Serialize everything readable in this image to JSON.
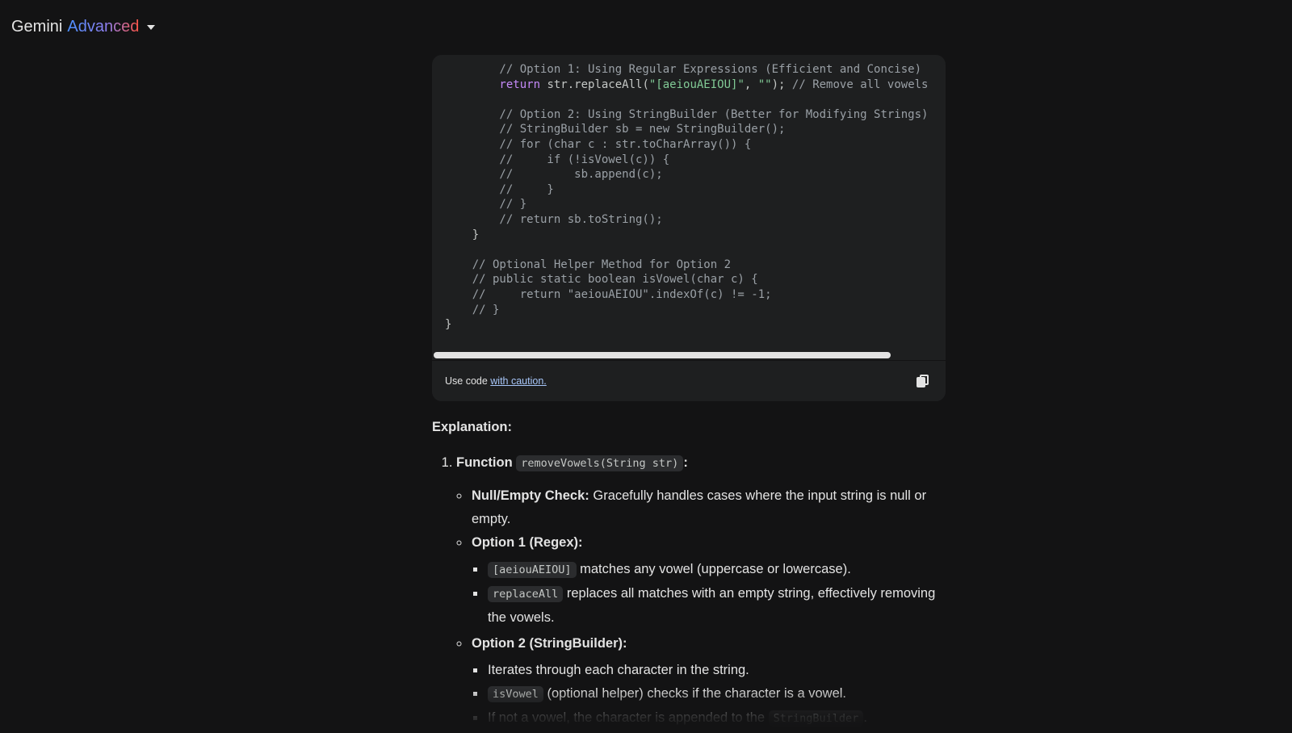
{
  "header": {
    "brand_name": "Gemini",
    "brand_tier": "Advanced",
    "dropdown_icon": "caret-down-icon"
  },
  "code_block": {
    "lines": [
      [
        {
          "t": "c",
          "v": "        // Option 1: Using Regular Expressions (Efficient and Concise)"
        }
      ],
      [
        {
          "t": "k",
          "v": "        return"
        },
        {
          "t": "p",
          "v": " str.replaceAll("
        },
        {
          "t": "s",
          "v": "\"[aeiouAEIOU]\""
        },
        {
          "t": "p",
          "v": ", "
        },
        {
          "t": "s",
          "v": "\"\""
        },
        {
          "t": "p",
          "v": "); "
        },
        {
          "t": "c",
          "v": "// Remove all vowels"
        }
      ],
      [
        {
          "t": "p",
          "v": ""
        }
      ],
      [
        {
          "t": "c",
          "v": "        // Option 2: Using StringBuilder (Better for Modifying Strings)"
        }
      ],
      [
        {
          "t": "c",
          "v": "        // StringBuilder sb = new StringBuilder();"
        }
      ],
      [
        {
          "t": "c",
          "v": "        // for (char c : str.toCharArray()) {"
        }
      ],
      [
        {
          "t": "c",
          "v": "        //     if (!isVowel(c)) {"
        }
      ],
      [
        {
          "t": "c",
          "v": "        //         sb.append(c);"
        }
      ],
      [
        {
          "t": "c",
          "v": "        //     }"
        }
      ],
      [
        {
          "t": "c",
          "v": "        // }"
        }
      ],
      [
        {
          "t": "c",
          "v": "        // return sb.toString();"
        }
      ],
      [
        {
          "t": "p",
          "v": "    }"
        }
      ],
      [
        {
          "t": "p",
          "v": ""
        }
      ],
      [
        {
          "t": "c",
          "v": "    // Optional Helper Method for Option 2"
        }
      ],
      [
        {
          "t": "c",
          "v": "    // public static boolean isVowel(char c) {"
        }
      ],
      [
        {
          "t": "c",
          "v": "    //     return \"aeiouAEIOU\".indexOf(c) != -1;"
        }
      ],
      [
        {
          "t": "c",
          "v": "    // }"
        }
      ],
      [
        {
          "t": "p",
          "v": "}"
        }
      ]
    ],
    "footer_prefix": "Use code ",
    "footer_link": "with caution.",
    "copy_icon": "copy-icon"
  },
  "explanation": {
    "heading": "Explanation:",
    "item1": {
      "number": "1.",
      "bold": "Function",
      "code": "removeVowels(String str)",
      "suffix": ":",
      "bullets": {
        "null_check": {
          "bold": "Null/Empty Check:",
          "text": " Gracefully handles cases where the input string is null or empty."
        },
        "option1": {
          "bold": "Option 1 (Regex):",
          "sub1_code": "[aeiouAEIOU]",
          "sub1_text": " matches any vowel (uppercase or lowercase).",
          "sub2_code": "replaceAll",
          "sub2_text": " replaces all matches with an empty string, effectively removing the vowels."
        },
        "option2": {
          "bold": "Option 2 (StringBuilder):",
          "sub1_text": "Iterates through each character in the string.",
          "sub2_code": "isVowel",
          "sub2_text": " (optional helper) checks if the character is a vowel.",
          "sub3_text": "If not a vowel, the character is appended to the ",
          "sub3_code": "StringBuilder",
          "sub3_suffix": "."
        }
      }
    }
  }
}
